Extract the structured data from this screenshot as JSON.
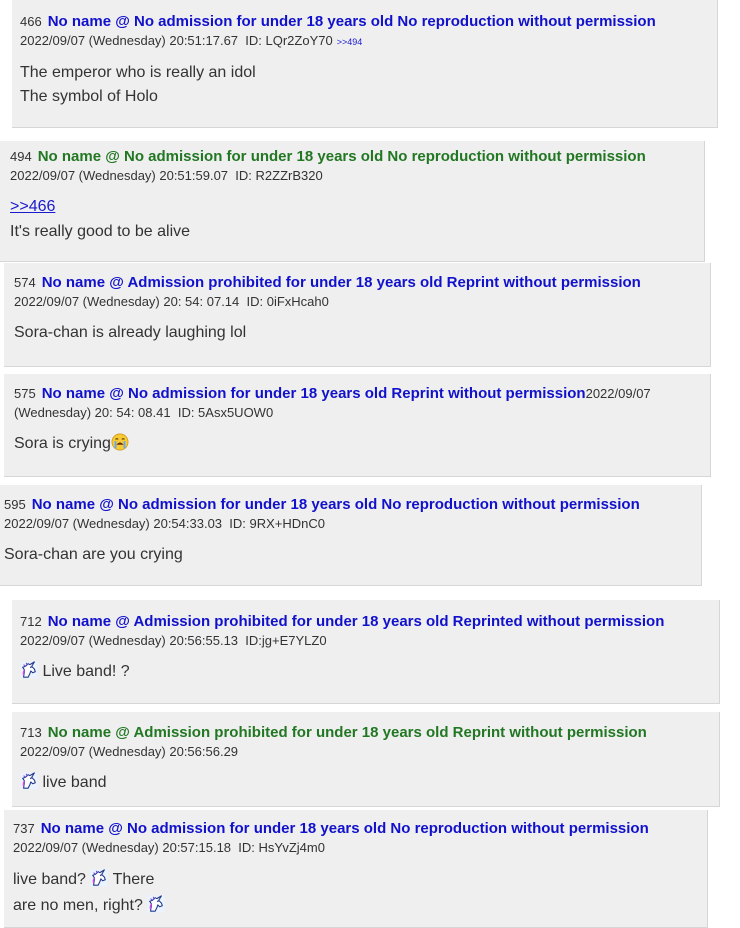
{
  "posts": [
    {
      "num": "466",
      "name": "No name @ No admission for under 18 years old No reproduction without permission",
      "date": "2022/09/07 (Wednesday) 20:51:17.67",
      "id": "ID: LQr2ZoY70",
      "reply": ">>494",
      "lines": [
        "The emperor who is really an idol",
        "The symbol of Holo"
      ]
    },
    {
      "num": "494",
      "name": "No name @ No admission for under 18 years old No reproduction without permission",
      "date": "2022/09/07 (Wednesday) 20:51:59.07",
      "id": "ID: R2ZZrB320",
      "anchor": ">>466",
      "lines": [
        "It's really good to be alive"
      ]
    },
    {
      "num": "574",
      "name": "No name @ Admission prohibited for under 18 years old Reprint without permission",
      "date": "2022/09/07 (Wednesday) 20: 54: 07.14",
      "id": "ID: 0iFxHcah0",
      "lines": [
        "Sora-chan is already laughing lol"
      ]
    },
    {
      "num": "575",
      "name": "No name @ No admission for under 18 years old Reprint without permission",
      "date_part1": "2022/09/07",
      "date_part2": "(Wednesday) 20: 54: 08.41",
      "id": "ID: 5Asx5UOW0",
      "lines": [
        "Sora is crying"
      ]
    },
    {
      "num": "595",
      "name": "No name @ No admission for under 18 years old No reproduction without permission",
      "date": "2022/09/07 (Wednesday) 20:54:33.03",
      "id": "ID: 9RX+HDnC0",
      "lines": [
        "Sora-chan are you crying"
      ]
    },
    {
      "num": "712",
      "name": "No name @ Admission prohibited for under 18 years old Reprinted without permission",
      "date": "2022/09/07 (Wednesday) 20:56:55.13",
      "id": "ID:jg+E7YLZ0",
      "lines": [
        "Live band! ?"
      ]
    },
    {
      "num": "713",
      "name": "No name @ Admission prohibited for under 18 years old Reprint without permission",
      "date": "2022/09/07 (Wednesday) 20:56:56.29",
      "lines": [
        "live band"
      ]
    },
    {
      "num": "737",
      "name": "No name @ No admission for under 18 years old No reproduction without permission",
      "date": "2022/09/07 (Wednesday) 20:57:15.18",
      "id": "ID: HsYvZj4m0",
      "line1a": "live band?",
      "line1b": "There",
      "line2": "are no men, right?"
    }
  ],
  "colors": {
    "name_blue": "#1111cc",
    "name_green": "#227722",
    "post_bg": "#efeff0"
  },
  "icons": [
    "unicorn-emoji-icon",
    "crying-face-emoji-icon"
  ]
}
